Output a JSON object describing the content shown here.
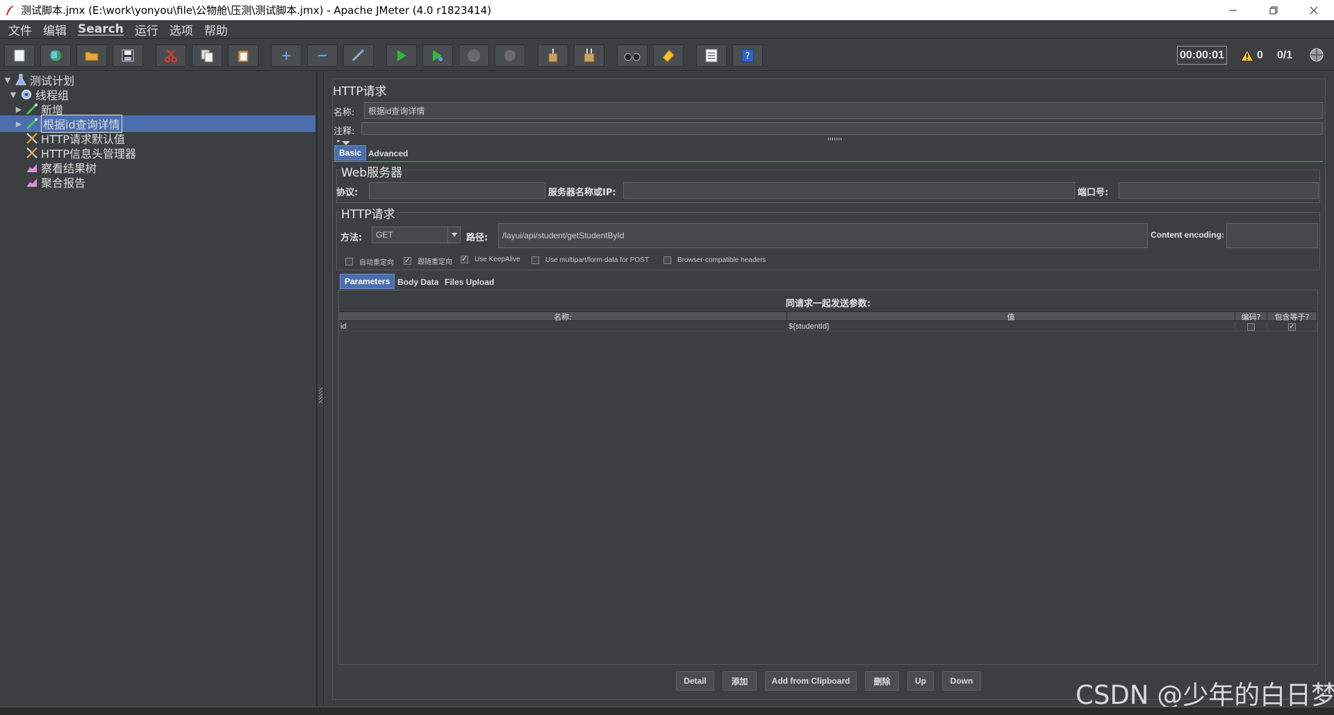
{
  "window": {
    "title": "测试脚本.jmx (E:\\work\\yonyou\\file\\公物舱\\压测\\测试脚本.jmx) - Apache JMeter (4.0 r1823414)"
  },
  "menu": [
    "文件",
    "编辑",
    "Search",
    "运行",
    "选项",
    "帮助"
  ],
  "toolbar": {
    "timer": "00:00:01",
    "warnings": "0",
    "threads": "0/1"
  },
  "tree": {
    "items": [
      {
        "label": "测试计划",
        "icon": "test-plan-icon"
      },
      {
        "label": "线程组",
        "icon": "thread-group-icon"
      },
      {
        "label": "新增",
        "icon": "sampler-icon"
      },
      {
        "label": "根据id查询详情",
        "icon": "sampler-icon"
      },
      {
        "label": "HTTP请求默认值",
        "icon": "config-icon"
      },
      {
        "label": "HTTP信息头管理器",
        "icon": "config-icon"
      },
      {
        "label": "察看结果树",
        "icon": "listener-icon"
      },
      {
        "label": "聚合报告",
        "icon": "listener-icon"
      }
    ]
  },
  "panel": {
    "title": "HTTP请求",
    "name_label": "名称:",
    "name_value": "根据id查询详情",
    "comment_label": "注释:",
    "comment_value": "",
    "tabs": [
      "Basic",
      "Advanced"
    ],
    "web_server": {
      "title": "Web服务器",
      "protocol_label": "协议:",
      "protocol_value": "",
      "server_label": "服务器名称或IP:",
      "server_value": "",
      "port_label": "端口号:",
      "port_value": ""
    },
    "http_request": {
      "title": "HTTP请求",
      "method_label": "方法:",
      "method_value": "GET",
      "path_label": "路径:",
      "path_value": "/layui/api/student/getStudentById",
      "encoding_label": "Content encoding:",
      "encoding_value": ""
    },
    "options": [
      {
        "label": "自动重定向",
        "checked": false
      },
      {
        "label": "跟随重定向",
        "checked": true
      },
      {
        "label": "Use KeepAlive",
        "checked": true
      },
      {
        "label": "Use multipart/form-data for POST",
        "checked": false
      },
      {
        "label": "Browser-compatible headers",
        "checked": false
      }
    ],
    "param_tabs": [
      "Parameters",
      "Body Data",
      "Files Upload"
    ],
    "params": {
      "title": "同请求一起发送参数:",
      "columns": [
        "名称:",
        "值",
        "编码?",
        "包含等于?"
      ],
      "rows": [
        {
          "name": "id",
          "value": "${studentId}",
          "encode": false,
          "include_equals": true
        }
      ]
    },
    "buttons": [
      "Detail",
      "添加",
      "Add from Clipboard",
      "删除",
      "Up",
      "Down"
    ]
  },
  "watermark": "CSDN @少年的白日梦"
}
